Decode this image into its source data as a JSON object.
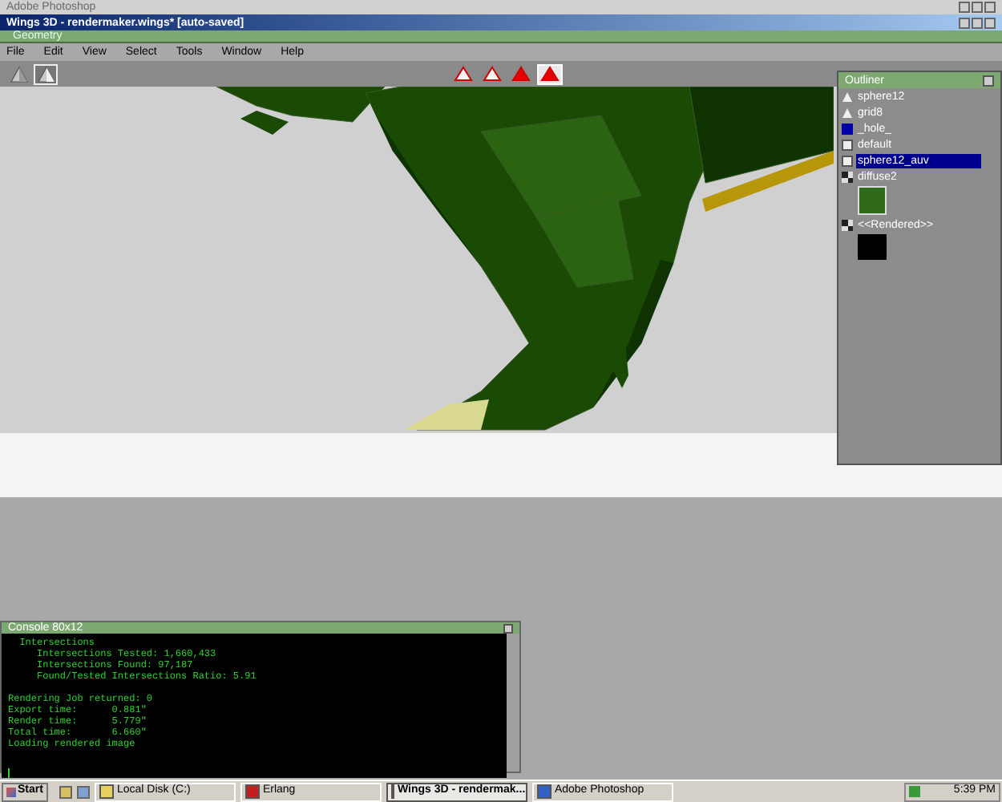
{
  "outer_window": {
    "title": "Adobe Photoshop"
  },
  "window": {
    "title": "Wings 3D - rendermaker.wings* [auto-saved]"
  },
  "geometry_bar": {
    "title": "Geometry"
  },
  "menu": [
    "File",
    "Edit",
    "View",
    "Select",
    "Tools",
    "Window",
    "Help"
  ],
  "view_buttons": [
    {
      "kind": "solid",
      "selected": false
    },
    {
      "kind": "split",
      "selected": true
    }
  ],
  "shading_buttons": [
    {
      "kind": "wire",
      "selected": false
    },
    {
      "kind": "wire",
      "selected": false
    },
    {
      "kind": "solid",
      "selected": false
    },
    {
      "kind": "solid",
      "selected": true
    }
  ],
  "outliner": {
    "title": "Outliner",
    "items": [
      {
        "kind": "mesh",
        "label": "sphere12",
        "selected": false
      },
      {
        "kind": "mesh",
        "label": "grid8",
        "selected": false
      },
      {
        "kind": "hole",
        "label": "_hole_",
        "selected": false
      },
      {
        "kind": "material",
        "label": "default",
        "selected": false
      },
      {
        "kind": "material",
        "label": "sphere12_auv",
        "selected": true
      },
      {
        "kind": "image",
        "label": "diffuse2",
        "selected": false
      },
      {
        "kind": "rendered",
        "label": "<<Rendered>>",
        "selected": false
      }
    ]
  },
  "console": {
    "title": "Console 80x12",
    "blocks": [
      [
        "  Intersections",
        "     Intersections Tested: 1,660,433",
        "     Intersections Found: 97,187",
        "     Found/Tested Intersections Ratio: 5.91"
      ],
      [
        "Rendering Job returned: 0",
        "Export time:      0.881\"",
        "Render time:      5.779\"",
        "Total time:       6.660\"",
        "Loading rendered image"
      ]
    ]
  },
  "taskbar": {
    "start": "Start",
    "tasks": [
      {
        "label": "Local Disk (C:)",
        "kind": "folder",
        "selected": false
      },
      {
        "label": "Erlang",
        "kind": "erlang",
        "selected": false
      },
      {
        "label": "Wings 3D - rendermak...",
        "kind": "wings",
        "selected": true
      },
      {
        "label": "Adobe Photoshop",
        "kind": "photoshop",
        "selected": false
      }
    ],
    "time": "5:39 PM"
  }
}
